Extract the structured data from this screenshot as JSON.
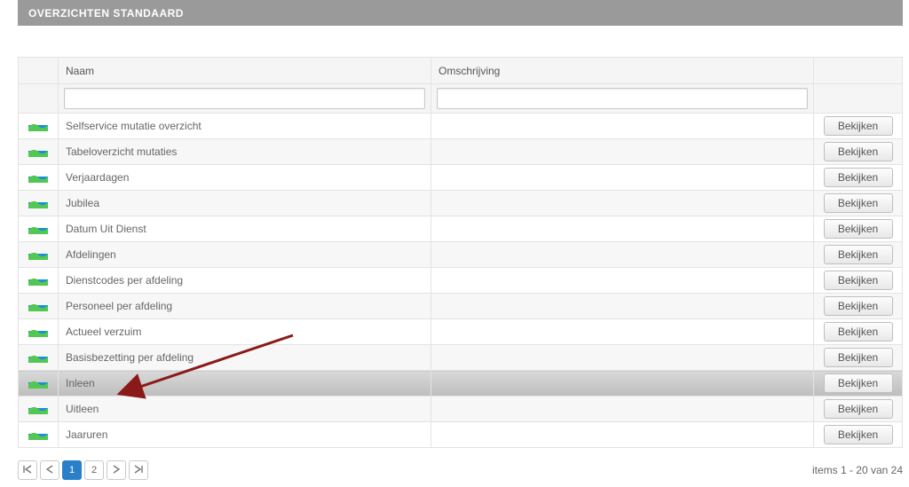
{
  "header": {
    "title": "OVERZICHTEN STANDAARD"
  },
  "columns": {
    "name": "Naam",
    "desc": "Omschrijving"
  },
  "filters": {
    "name_value": "",
    "desc_value": ""
  },
  "action_label": "Bekijken",
  "rows": [
    {
      "name": "Selfservice mutatie overzicht",
      "desc": "",
      "highlight": false
    },
    {
      "name": "Tabeloverzicht mutaties",
      "desc": "",
      "highlight": false
    },
    {
      "name": "Verjaardagen",
      "desc": "",
      "highlight": false
    },
    {
      "name": "Jubilea",
      "desc": "",
      "highlight": false
    },
    {
      "name": "Datum Uit Dienst",
      "desc": "",
      "highlight": false
    },
    {
      "name": "Afdelingen",
      "desc": "",
      "highlight": false
    },
    {
      "name": "Dienstcodes per afdeling",
      "desc": "",
      "highlight": false
    },
    {
      "name": "Personeel per afdeling",
      "desc": "",
      "highlight": false
    },
    {
      "name": "Actueel verzuim",
      "desc": "",
      "highlight": false
    },
    {
      "name": "Basisbezetting per afdeling",
      "desc": "",
      "highlight": false
    },
    {
      "name": "Inleen",
      "desc": "",
      "highlight": true
    },
    {
      "name": "Uitleen",
      "desc": "",
      "highlight": false
    },
    {
      "name": "Jaaruren",
      "desc": "",
      "highlight": false
    }
  ],
  "pager": {
    "pages": [
      "1",
      "2"
    ],
    "current": "1",
    "status": "items 1 - 20 van 24"
  },
  "icons": {
    "row_icon": "report-icon",
    "first": "«",
    "prev": "‹",
    "next": "›",
    "last": "»"
  }
}
